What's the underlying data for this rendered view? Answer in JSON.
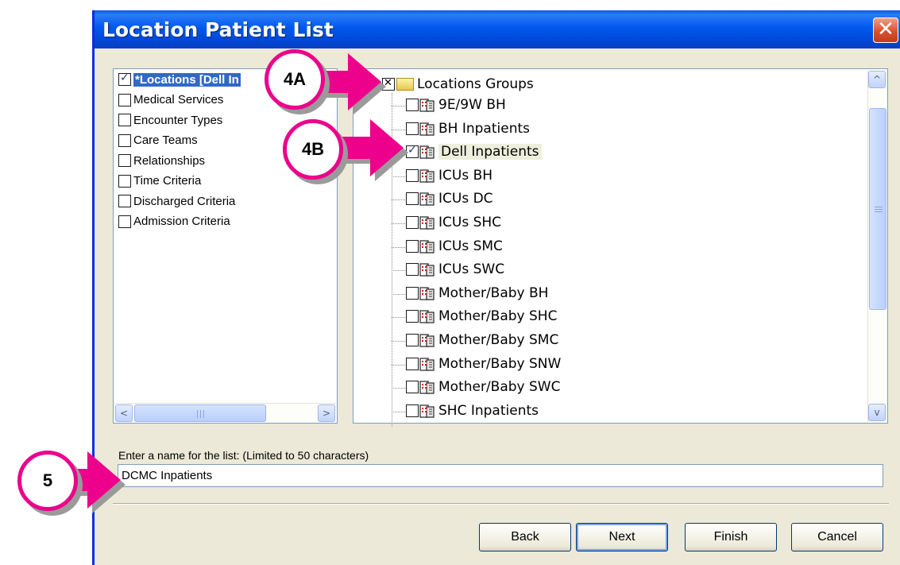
{
  "window": {
    "title": "Location Patient List",
    "close_glyph": "✕"
  },
  "criteria": [
    {
      "label": "*Locations [Dell In",
      "checked": true,
      "selected": true
    },
    {
      "label": "Medical Services",
      "checked": false
    },
    {
      "label": "Encounter Types",
      "checked": false
    },
    {
      "label": "Care Teams",
      "checked": false
    },
    {
      "label": "Relationships",
      "checked": false
    },
    {
      "label": "Time Criteria",
      "checked": false
    },
    {
      "label": "Discharged Criteria",
      "checked": false
    },
    {
      "label": "Admission Criteria",
      "checked": false
    }
  ],
  "tree": {
    "root_label": "Locations Groups",
    "root_state": "indeterminate",
    "items": [
      {
        "label": "9E/9W BH",
        "checked": false
      },
      {
        "label": "BH Inpatients",
        "checked": false
      },
      {
        "label": "Dell Inpatients",
        "checked": true
      },
      {
        "label": "ICUs BH",
        "checked": false
      },
      {
        "label": "ICUs DC",
        "checked": false
      },
      {
        "label": "ICUs SHC",
        "checked": false
      },
      {
        "label": "ICUs SMC",
        "checked": false
      },
      {
        "label": "ICUs SWC",
        "checked": false
      },
      {
        "label": "Mother/Baby BH",
        "checked": false
      },
      {
        "label": "Mother/Baby SHC",
        "checked": false
      },
      {
        "label": "Mother/Baby SMC",
        "checked": false
      },
      {
        "label": "Mother/Baby SNW",
        "checked": false
      },
      {
        "label": "Mother/Baby SWC",
        "checked": false
      },
      {
        "label": "SHC Inpatients",
        "checked": false
      }
    ]
  },
  "name_field": {
    "label": "Enter a name for the list: (Limited to 50 characters)",
    "value": "DCMC Inpatients"
  },
  "buttons": {
    "back": "Back",
    "next": "Next",
    "finish": "Finish",
    "cancel": "Cancel"
  },
  "annotations": {
    "a4a": "4A",
    "a4b": "4B",
    "a5": "5",
    "accent": "#ec008c"
  },
  "scroll": {
    "left_arrow": "<",
    "right_arrow": ">",
    "up_arrow": "^",
    "down_arrow": "v"
  }
}
